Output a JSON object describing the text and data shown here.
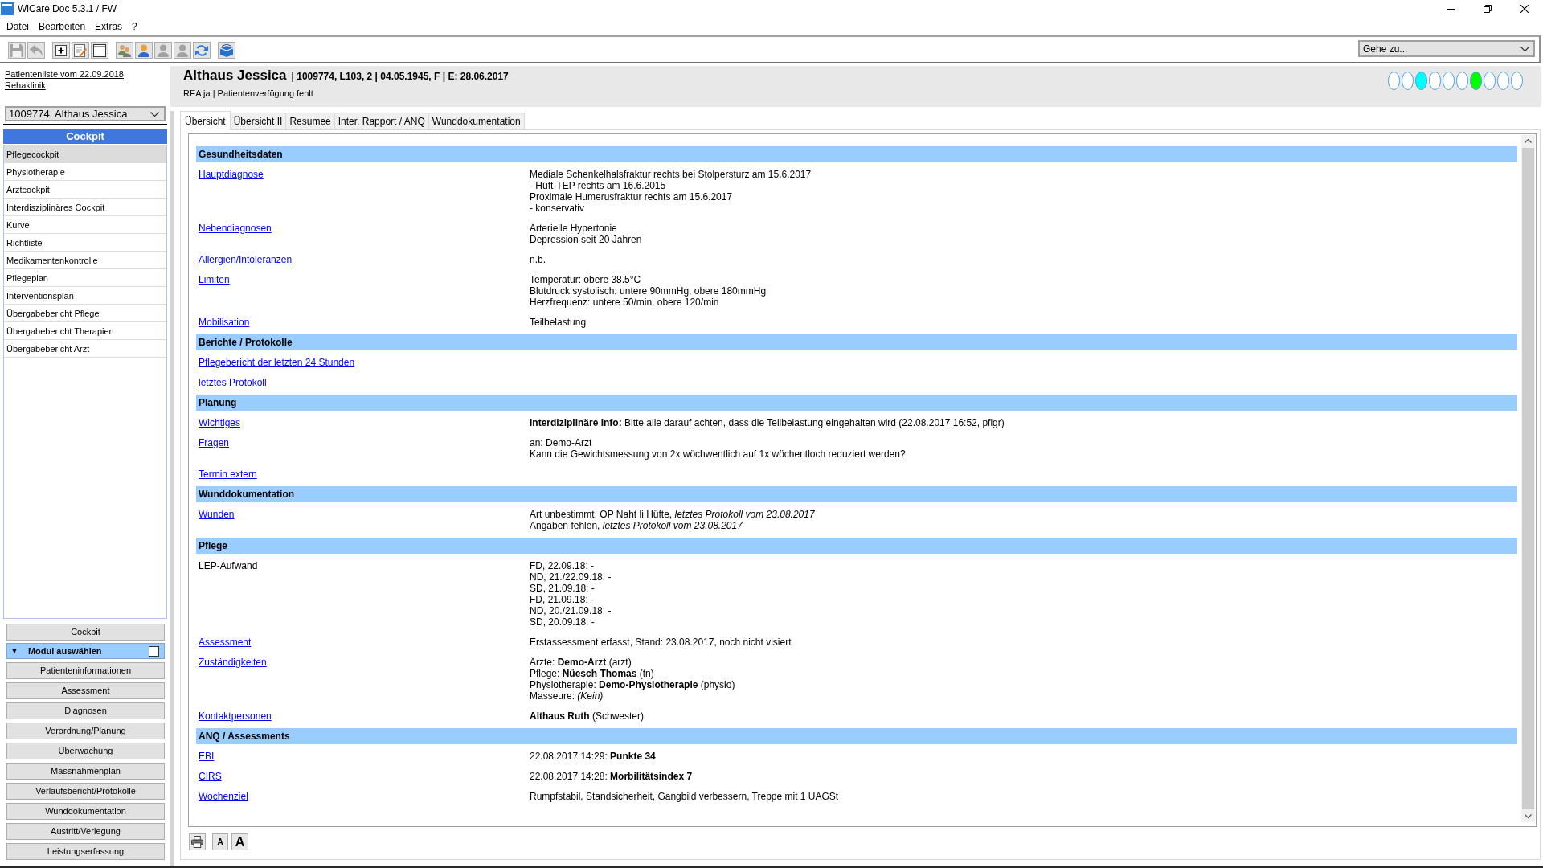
{
  "window": {
    "title": "WiCare|Doc 5.3.1 / FW"
  },
  "menu": [
    "Datei",
    "Bearbeiten",
    "Extras",
    "?"
  ],
  "toolbar": {
    "groups": [
      [
        {
          "kind": "save",
          "disabled": true
        },
        {
          "kind": "undo",
          "disabled": true
        }
      ],
      [
        {
          "kind": "add",
          "disabled": false
        },
        {
          "kind": "edit",
          "disabled": false
        },
        {
          "kind": "window",
          "disabled": false
        }
      ],
      [
        {
          "kind": "group",
          "disabled": false
        },
        {
          "kind": "person",
          "disabled": false
        },
        {
          "kind": "person",
          "disabled": true
        },
        {
          "kind": "person",
          "disabled": true
        },
        {
          "kind": "refresh",
          "disabled": false
        }
      ],
      [
        {
          "kind": "box",
          "disabled": false
        }
      ]
    ],
    "goto": {
      "placeholder": "Gehe zu..."
    }
  },
  "sidebar": {
    "links": [
      "Patientenliste vom 22.09.2018",
      "Rehaklinik"
    ],
    "patient_select": {
      "value": "1009774, Althaus Jessica"
    },
    "cockpit": {
      "title": "Cockpit",
      "items": [
        {
          "label": "Pflegecockpit",
          "selected": true
        },
        {
          "label": "Physiotherapie",
          "selected": false
        },
        {
          "label": "Arztcockpit",
          "selected": false
        },
        {
          "label": "Interdisziplinäres Cockpit",
          "selected": false
        },
        {
          "label": "Kurve",
          "selected": false
        },
        {
          "label": "Richtliste",
          "selected": false
        },
        {
          "label": "Medikamentenkontrolle",
          "selected": false
        },
        {
          "label": "Pflegeplan",
          "selected": false
        },
        {
          "label": "Interventionsplan",
          "selected": false
        },
        {
          "label": "Übergabebericht Pflege",
          "selected": false
        },
        {
          "label": "Übergabebericht Therapien",
          "selected": false
        },
        {
          "label": "Übergabebericht Arzt",
          "selected": false
        }
      ]
    },
    "cockpit_button": "Cockpit",
    "module_header": {
      "arrow": "▼",
      "title": "Modul auswählen",
      "checked": false
    },
    "module_buttons": [
      "Patienteninformationen",
      "Assessment",
      "Diagnosen",
      "Verordnung/Planung",
      "Überwachung",
      "Massnahmenplan",
      "Verlaufsbericht/Protokolle",
      "Wunddokumentation",
      "Austritt/Verlegung",
      "Leistungserfassung"
    ]
  },
  "patient_header": {
    "name": "Althaus Jessica",
    "details": "| 1009774, L103, 2 | 04.05.1945, F | E: 28.06.2017",
    "subtitle": "REA ja | Patientenverfügung fehlt",
    "indicators": [
      {
        "color": "#ffffff"
      },
      {
        "color": "#ffffff"
      },
      {
        "color": "#00ffff"
      },
      {
        "color": "#ffffff"
      },
      {
        "color": "#ffffff"
      },
      {
        "color": "#ffffff"
      },
      {
        "color": "#00ff00"
      },
      {
        "color": "#ffffff"
      },
      {
        "color": "#ffffff"
      },
      {
        "color": "#ffffff"
      }
    ]
  },
  "tabs": [
    {
      "label": "Übersicht",
      "selected": true
    },
    {
      "label": "Übersicht II",
      "selected": false
    },
    {
      "label": "Resumee",
      "selected": false
    },
    {
      "label": "Inter. Rapport / ANQ",
      "selected": false
    },
    {
      "label": "Wunddokumentation",
      "selected": false
    }
  ],
  "sections": [
    {
      "title": "Gesundheitsdaten",
      "rows": [
        {
          "label": "Hauptdiagnose",
          "kind": "link",
          "lines": [
            "Mediale Schenkelhalsfraktur rechts bei Stolpersturz am 15.6.2017",
            "- Hüft-TEP rechts am 16.6.2015",
            "Proximale Humerusfraktur rechts am 15.6.2017",
            "- konservativ"
          ]
        },
        {
          "label": "Nebendiagnosen",
          "kind": "link",
          "lines": [
            "Arterielle Hypertonie",
            "Depression seit 20 Jahren"
          ]
        },
        {
          "label": "Allergien/Intoleranzen",
          "kind": "link",
          "lines": [
            "n.b."
          ]
        },
        {
          "label": "Limiten",
          "kind": "link",
          "lines": [
            "Temperatur: obere 38.5°C",
            "Blutdruck systolisch: untere 90mmHg, obere 180mmHg",
            "Herzfrequenz: untere 50/min, obere 120/min"
          ]
        },
        {
          "label": "Mobilisation",
          "kind": "link",
          "lines": [
            "Teilbelastung"
          ]
        }
      ]
    },
    {
      "title": "Berichte / Protokolle",
      "rows": [
        {
          "label": "Pflegebericht der letzten 24 Stunden",
          "kind": "link"
        },
        {
          "label": "letztes Protokoll",
          "kind": "link"
        }
      ]
    },
    {
      "title": "Planung",
      "rows": [
        {
          "label": "Wichtiges",
          "kind": "link",
          "lines": [
            "**Interdiziplinäre Info:** Bitte alle darauf achten, dass die Teilbelastung eingehalten wird (22.08.2017 16:52, pflgr)"
          ]
        },
        {
          "label": "Fragen",
          "kind": "link",
          "lines": [
            "an: Demo-Arzt",
            "Kann die Gewichtsmessung von 2x wöchwentlich auf 1x wöchentloch reduziert werden?"
          ]
        },
        {
          "label": "Termin extern",
          "kind": "link"
        }
      ]
    },
    {
      "title": "Wunddokumentation",
      "rows": [
        {
          "label": "Wunden",
          "kind": "link",
          "lines": [
            "Art unbestimmt, OP Naht li Hüfte, *letztes Protokoll vom 23.08.2017*",
            "Angaben fehlen, *letztes Protokoll vom 23.08.2017*"
          ]
        }
      ]
    },
    {
      "title": "Pflege",
      "rows": [
        {
          "label": "LEP-Aufwand",
          "kind": "text",
          "lines": [
            "FD, 22.09.18: -",
            "ND, 21./22.09.18: -",
            "SD, 21.09.18: -",
            "FD, 21.09.18: -",
            "ND, 20./21.09.18: -",
            "SD, 20.09.18: -"
          ]
        },
        {
          "label": "Assessment",
          "kind": "link",
          "lines": [
            "Erstassessment erfasst, Stand: 23.08.2017, noch nicht visiert"
          ]
        },
        {
          "label": "Zuständigkeiten",
          "kind": "link",
          "lines": [
            "Ärzte: **Demo-Arzt** (arzt)",
            "Pflege: **Nüesch Thomas** (tn)",
            "Physiotherapie: **Demo-Physiotherapie** (physio)",
            "Masseure: *(Kein)*"
          ]
        },
        {
          "label": "Kontaktpersonen",
          "kind": "link",
          "lines": [
            "**Althaus Ruth** (Schwester)"
          ]
        }
      ]
    },
    {
      "title": "ANQ / Assessments",
      "rows": [
        {
          "label": "EBI",
          "kind": "link",
          "lines": [
            "22.08.2017 14:29: **Punkte 34**"
          ]
        },
        {
          "label": "CIRS",
          "kind": "link",
          "lines": [
            "22.08.2017 14:28: **Morbilitätsindex 7**"
          ]
        },
        {
          "label": "Wochenziel",
          "kind": "link",
          "lines": [
            "Rumpfstabil, Standsicherheit, Gangbild verbessern, Treppe mit 1 UAGSt"
          ]
        }
      ]
    }
  ],
  "bottom_toolbar": {
    "font_buttons": [
      {
        "label": "A",
        "kind": "small"
      },
      {
        "label": "A",
        "kind": "large"
      }
    ]
  }
}
